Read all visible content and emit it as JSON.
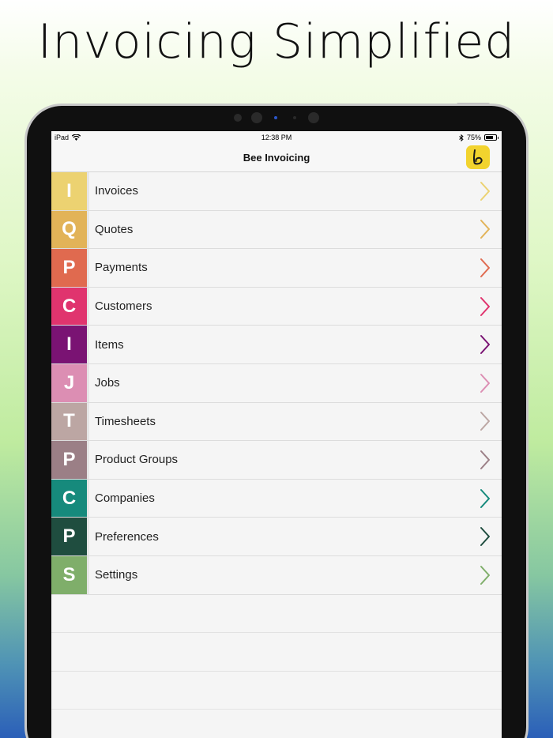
{
  "headline": "Invoicing Simplified",
  "status_bar": {
    "device": "iPad",
    "time": "12:38 PM",
    "battery": "75%",
    "battery_fraction": 0.75
  },
  "navbar": {
    "title": "Bee Invoicing"
  },
  "menu": [
    {
      "letter": "I",
      "label": "Invoices",
      "color": "#ecd271"
    },
    {
      "letter": "Q",
      "label": "Quotes",
      "color": "#e2b358"
    },
    {
      "letter": "P",
      "label": "Payments",
      "color": "#e06a4f"
    },
    {
      "letter": "C",
      "label": "Customers",
      "color": "#e0346e"
    },
    {
      "letter": "I",
      "label": "Items",
      "color": "#7a1373"
    },
    {
      "letter": "J",
      "label": "Jobs",
      "color": "#dc8eb3"
    },
    {
      "letter": "T",
      "label": "Timesheets",
      "color": "#bca6a3"
    },
    {
      "letter": "P",
      "label": "Product Groups",
      "color": "#9b7f86"
    },
    {
      "letter": "C",
      "label": "Companies",
      "color": "#168a7c"
    },
    {
      "letter": "P",
      "label": "Preferences",
      "color": "#1f4d3f"
    },
    {
      "letter": "S",
      "label": "Settings",
      "color": "#7fae6a"
    }
  ],
  "icons": {
    "chevron": "chevron-right-icon",
    "wifi": "wifi-icon",
    "bluetooth": "bluetooth-icon",
    "battery": "battery-icon",
    "logo": "bee-logo-icon"
  }
}
